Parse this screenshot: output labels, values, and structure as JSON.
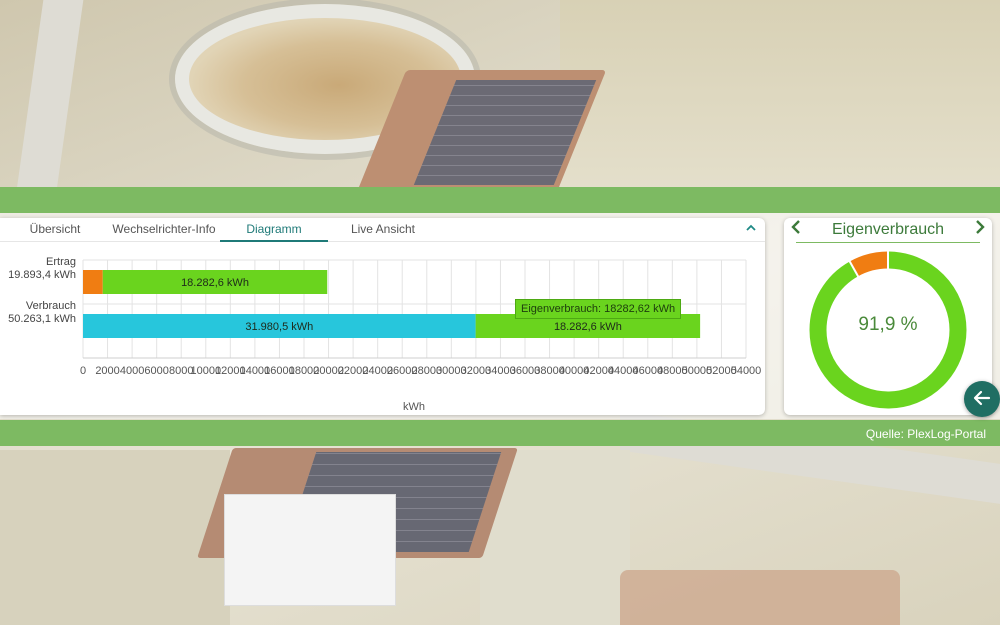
{
  "tabs": [
    {
      "label": "Übersicht",
      "active": false
    },
    {
      "label": "Wechselrichter-Info",
      "active": false
    },
    {
      "label": "Diagramm",
      "active": true
    },
    {
      "label": "Live Ansicht",
      "active": false
    }
  ],
  "collapse_icon": "chevron-up-icon",
  "chart_data": {
    "type": "bar",
    "orientation": "horizontal",
    "stacked": true,
    "categories": [
      {
        "name": "Ertrag",
        "total": "19.893,4 kWh"
      },
      {
        "name": "Verbrauch",
        "total": "50.263,1 kWh"
      }
    ],
    "series": [
      {
        "color": "#f07d12",
        "values": [
          1610.8,
          0
        ],
        "labels": [
          "",
          ""
        ]
      },
      {
        "color": "#6ad41e",
        "values": [
          18282.6,
          0
        ],
        "labels": [
          "18.282,6 kWh",
          ""
        ]
      },
      {
        "color": "#27c6dc",
        "values": [
          0,
          31980.5
        ],
        "labels": [
          "",
          "31.980,5 kWh"
        ]
      },
      {
        "color": "#6ad41e",
        "values": [
          0,
          18282.6
        ],
        "labels": [
          "",
          "18.282,6 kWh"
        ]
      }
    ],
    "xlim": [
      0,
      54000
    ],
    "xticks": [
      0,
      2000,
      4000,
      6000,
      8000,
      10000,
      12000,
      14000,
      16000,
      18000,
      20000,
      22000,
      24000,
      26000,
      28000,
      30000,
      32000,
      34000,
      36000,
      38000,
      40000,
      42000,
      44000,
      46000,
      48000,
      50000,
      52000,
      54000
    ],
    "xlabel": "kWh",
    "grid": true,
    "tooltip": "Eigenverbrauch: 18282,62 kWh"
  },
  "side": {
    "title": "Eigenverbrauch",
    "value": "91,9 %",
    "percent": 91.9,
    "colors": {
      "main": "#6ad41e",
      "rest": "#f07d12"
    },
    "prev_icon": "chevron-left-icon",
    "next_icon": "chevron-right-icon"
  },
  "back_button_icon": "arrow-left-icon",
  "footer": {
    "source": "Quelle: PlexLog-Portal"
  }
}
